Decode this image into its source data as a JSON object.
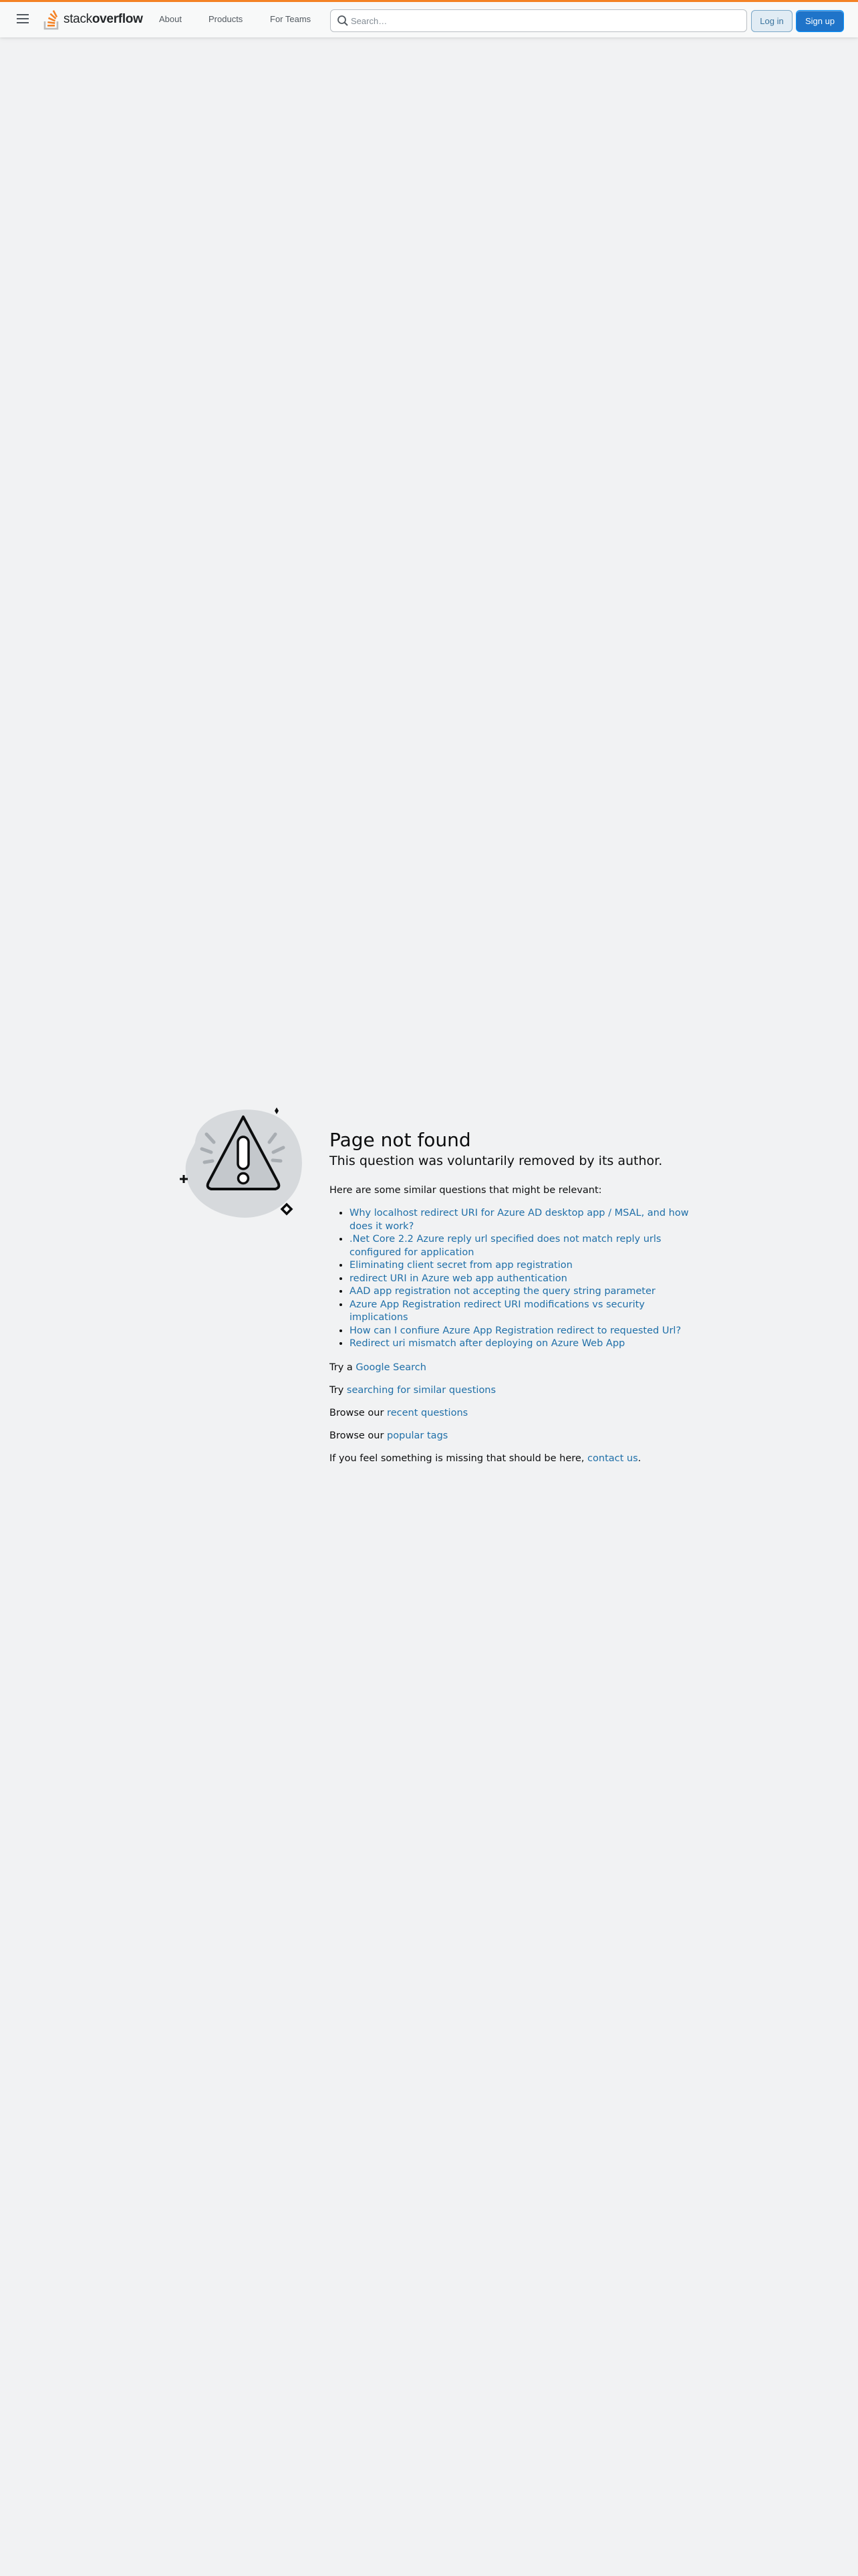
{
  "header": {
    "logo_text_plain": "stack",
    "logo_text_bold": "overflow",
    "nav": [
      "About",
      "Products",
      "For Teams"
    ],
    "search_placeholder": "Search…",
    "login_label": "Log in",
    "signup_label": "Sign up",
    "accent_color": "#f48225"
  },
  "main": {
    "title": "Page not found",
    "subtitle": "This question was voluntarily removed by its author.",
    "intro": "Here are some similar questions that might be relevant:",
    "similar_questions": [
      "Why localhost redirect URI for Azure AD desktop app / MSAL, and how does it work?",
      ".Net Core 2.2 Azure reply url specified does not match reply urls configured for application",
      "Eliminating client secret from app registration",
      "redirect URI in Azure web app authentication",
      "AAD app registration not accepting the query string parameter",
      "Azure App Registration redirect URI modifications vs security implications",
      "How can I confiure Azure App Registration redirect to requested Url?",
      "Redirect uri mismatch after deploying on Azure Web App"
    ],
    "google_prefix": "Try a ",
    "google_link": "Google Search",
    "search_prefix": "Try ",
    "search_link": "searching for similar questions",
    "recent_prefix": "Browse our ",
    "recent_link": "recent questions",
    "tags_prefix": "Browse our ",
    "tags_link": "popular tags",
    "contact_prefix": "If you feel something is missing that should be here, ",
    "contact_link": "contact us",
    "contact_suffix": ".",
    "link_color": "#1f6fa8"
  },
  "icons": {
    "menu": "hamburger-menu-icon",
    "logo": "stackoverflow-logo-icon",
    "search": "search-icon",
    "illustration": "warning-triangle-icon"
  }
}
